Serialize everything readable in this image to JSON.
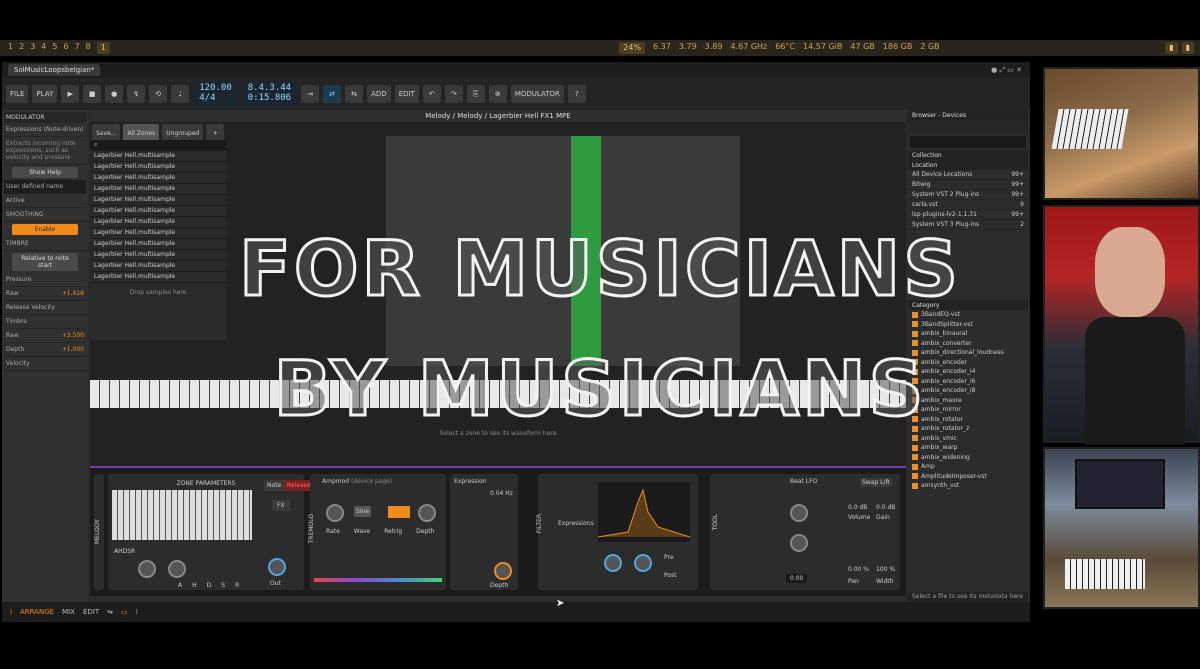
{
  "system_bar": {
    "left_tabs": [
      "1",
      "2",
      "3",
      "4",
      "5",
      "6",
      "7",
      "8",
      "1"
    ],
    "stats": [
      "24%",
      "6.37",
      "3.79",
      "3.89",
      "4.67 GHz",
      "66°C",
      "14.57 GiB",
      "47 GB",
      "186 GB",
      "2 GB"
    ]
  },
  "app": {
    "tab_title": "SolMusicLoopsbelgian*",
    "toolbar": {
      "file": "FILE",
      "play_label": "PLAY",
      "tempo": "120.00",
      "signature": "4/4",
      "position": "8.4.3.44",
      "time": "0:15.806",
      "add": "ADD",
      "edit": "EDIT",
      "modulator": "MODULATOR"
    },
    "modulator_panel": {
      "header": "MODULATOR",
      "name": "Expressions (Note-driven)",
      "desc": "Extracts incoming note expressions, such as velocity and pressure",
      "show_help": "Show Help",
      "user_name": "User defined name",
      "active": "Active",
      "smoothing": "SMOOTHING",
      "enable": "Enable",
      "timbre": "TIMBRE",
      "relative": "Relative to note start",
      "pressure": "Pressure",
      "raw1": "Raw",
      "raw1_val": "+1.418",
      "release_velocity": "Release Velocity",
      "timbre2": "Timbre",
      "raw2": "Raw",
      "raw2_val": "+3.500",
      "depth": "Depth",
      "depth_val": "+1.000",
      "velocity": "Velocity"
    },
    "center": {
      "title": "Melody / Melody / Lagerbier Hell FX1 MPE",
      "save": "Save...",
      "all_zones": "All Zones",
      "ungrouped": "Ungrouped",
      "items": [
        "Lagerbier Hell.multisample",
        "Lagerbier Hell.multisample",
        "Lagerbier Hell.multisample",
        "Lagerbier Hell.multisample",
        "Lagerbier Hell.multisample",
        "Lagerbier Hell.multisample",
        "Lagerbier Hell.multisample",
        "Lagerbier Hell.multisample",
        "Lagerbier Hell.multisample",
        "Lagerbier Hell.multisample",
        "Lagerbier Hell.multisample",
        "Lagerbier Hell.multisample"
      ],
      "drop": "Drop samples here",
      "select_zone": "Select a zone to see its waveform here"
    },
    "device": {
      "melody": "MELODY",
      "zone_params": "ZONE PARAMETERS",
      "note": "Note",
      "release": "Release",
      "fx": "FX",
      "ahdsr": "AHDSR",
      "ahdsr_labels": [
        "A",
        "H",
        "D",
        "S",
        "R"
      ],
      "out": "Out",
      "ampmod": "Ampmod",
      "ampmod_sub": "(device page)",
      "tremolo": "TREMOLO",
      "rate": "Rate",
      "wave": "Wave",
      "wave_val": "Sine",
      "retrig": "Retrig",
      "depth": "Depth",
      "expression": "Expression",
      "hz": "0.04 Hz",
      "depth2": "Depth",
      "filter": "FILTER",
      "expressions": "Expressions",
      "pre": "Pre",
      "post": "Post",
      "tool": "TOOL",
      "beat_lfo": "Beat LFO",
      "swap": "Swap L/R",
      "volume": "Volume",
      "gain": "Gain",
      "vol_val": "0.0 dB",
      "gain_val": "0.0 dB",
      "pan": "Pan",
      "width": "Width",
      "pan_val": "0.00 %",
      "width_val": "100 %",
      "small_val": "0.00"
    },
    "browser": {
      "header": "Browser - Devices",
      "collection": "Collection",
      "location": "Location",
      "rows": [
        {
          "name": "All Device Locations",
          "count": "99+"
        },
        {
          "name": "Bitwig",
          "count": "99+"
        },
        {
          "name": "System VST 2 Plug-ins",
          "count": "99+"
        },
        {
          "name": "carla.vst",
          "count": "9"
        },
        {
          "name": "lsp-plugins-lv2-1.1.31",
          "count": "99+"
        },
        {
          "name": "System VST 3 Plug-ins",
          "count": "2"
        }
      ],
      "category": "Category",
      "items": [
        "3BandEQ-vst",
        "3BandSplitter-vst",
        "ambix_binaural",
        "ambix_converter",
        "ambix_directional_loudness",
        "ambix_encoder",
        "ambix_encoder_i4",
        "ambix_encoder_i6",
        "ambix_encoder_i8",
        "ambix_maxre",
        "ambix_mirror",
        "ambix_rotator",
        "ambix_rotator_z",
        "ambix_vmic",
        "ambix_warp",
        "ambix_widening",
        "Amp",
        "AmplitudeImposer-vst",
        "amsynth_vst"
      ],
      "footer": "Select a file to see its metadata here"
    },
    "statusbar": {
      "arrange": "ARRANGE",
      "mix": "MIX",
      "edit": "EDIT"
    }
  },
  "overlay": {
    "line1": "FOR MUSICIANS",
    "line2": "BY MUSICIANS"
  }
}
